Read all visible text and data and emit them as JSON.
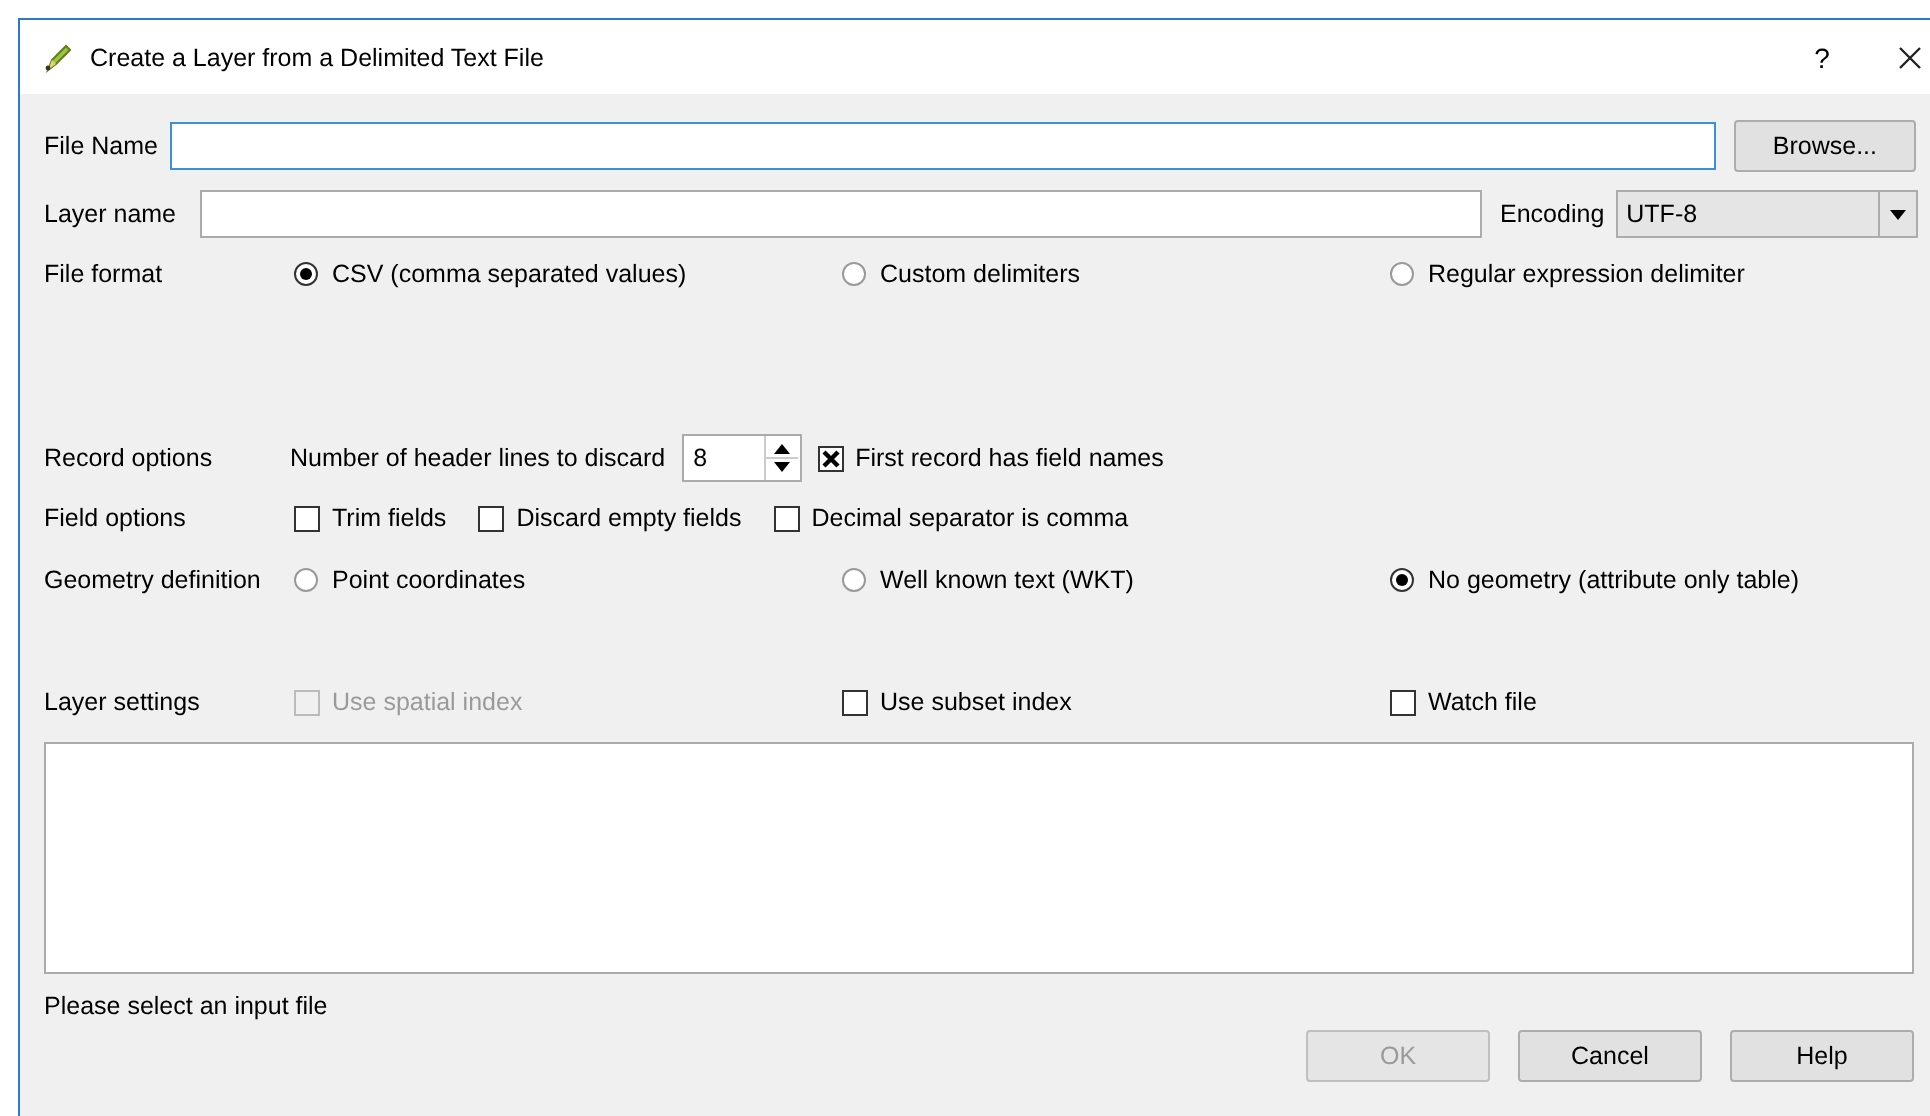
{
  "window": {
    "title": "Create a Layer from a Delimited Text File",
    "help": "?"
  },
  "file_name": {
    "label": "File Name",
    "browse": "Browse..."
  },
  "layer_name": {
    "label": "Layer name"
  },
  "encoding": {
    "label": "Encoding",
    "value": "UTF-8"
  },
  "file_format": {
    "label": "File format",
    "options": [
      {
        "label": "CSV (comma separated values)",
        "selected": true
      },
      {
        "label": "Custom delimiters",
        "selected": false
      },
      {
        "label": "Regular expression delimiter",
        "selected": false
      }
    ]
  },
  "record_options": {
    "label": "Record options",
    "header_lines": {
      "label": "Number of header lines to discard",
      "value": "8"
    },
    "first_record": {
      "label": "First record has field names",
      "checked": true
    }
  },
  "field_options": {
    "label": "Field options",
    "options": [
      {
        "label": "Trim fields",
        "checked": false
      },
      {
        "label": "Discard empty fields",
        "checked": false
      },
      {
        "label": "Decimal separator is comma",
        "checked": false
      }
    ]
  },
  "geometry_definition": {
    "label": "Geometry definition",
    "options": [
      {
        "label": "Point coordinates",
        "selected": false
      },
      {
        "label": "Well known text (WKT)",
        "selected": false
      },
      {
        "label": "No geometry (attribute only table)",
        "selected": true
      }
    ]
  },
  "layer_settings": {
    "label": "Layer settings",
    "options": [
      {
        "label": "Use spatial index",
        "checked": false,
        "disabled": true
      },
      {
        "label": "Use subset index",
        "checked": false,
        "disabled": false
      },
      {
        "label": "Watch file",
        "checked": false,
        "disabled": false
      }
    ]
  },
  "status": "Please select an input file",
  "buttons": [
    {
      "label": "OK",
      "disabled": true
    },
    {
      "label": "Cancel",
      "disabled": false
    },
    {
      "label": "Help",
      "disabled": false
    }
  ]
}
